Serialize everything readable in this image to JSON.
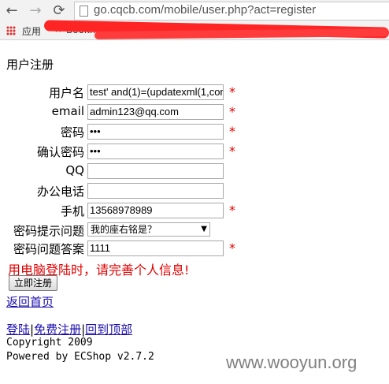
{
  "browser": {
    "url_text": "go.cqcb.com/mobile/user.php?act=register",
    "bookmarks": {
      "apps_label": "应用",
      "bookmarks_label": "Bookmarks"
    }
  },
  "page": {
    "title": "用户注册",
    "form": {
      "username": {
        "label": "用户名",
        "value": "test' and(1)=(updatexml(1,con"
      },
      "email": {
        "label": "email",
        "value": "admin123@qq.com"
      },
      "password": {
        "label": "密码",
        "value": "•••"
      },
      "confirm_password": {
        "label": "确认密码",
        "value": "•••"
      },
      "qq": {
        "label": "QQ",
        "value": ""
      },
      "office_phone": {
        "label": "办公电话",
        "value": ""
      },
      "mobile": {
        "label": "手机",
        "value": "13568978989"
      },
      "question": {
        "label": "密码提示问题",
        "selected": "我的座右铭是？"
      },
      "answer": {
        "label": "密码问题答案",
        "value": "1111"
      },
      "required_mark": "*",
      "notice": "用电脑登陆时，请完善个人信息!",
      "submit_label": "立即注册"
    },
    "back_link": "返回首页",
    "footer": {
      "login": "登陆",
      "sep1": "|",
      "register": "免费注册",
      "sep2": "|",
      "top": "回到顶部",
      "copyright": "Copyright 2009",
      "powered": "Powered by ECShop v2.7.2"
    },
    "watermark": "www.wooyun.org"
  }
}
